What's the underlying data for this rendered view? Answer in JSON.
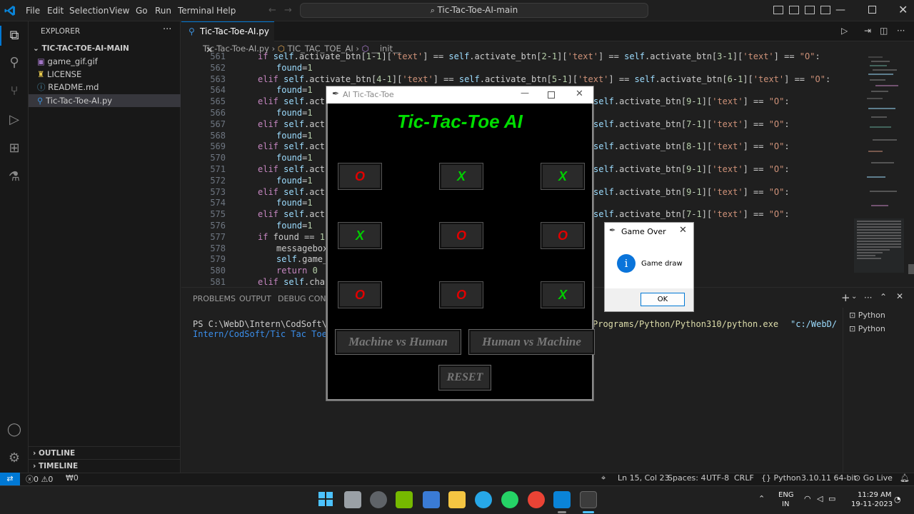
{
  "titlebar": {
    "menus": [
      "File",
      "Edit",
      "Selection",
      "View",
      "Go",
      "Run",
      "Terminal",
      "Help"
    ],
    "search": "Tic-Tac-Toe-AI-main"
  },
  "sidebar": {
    "header": "EXPLORER",
    "root": "TIC-TAC-TOE-AI-MAIN",
    "files": [
      "game_gif.gif",
      "LICENSE",
      "README.md",
      "Tic-Tac-Toe-AI.py"
    ],
    "outline": "OUTLINE",
    "timeline": "TIMELINE"
  },
  "editor": {
    "tab": "Tic-Tac-Toe-AI.py",
    "breadcrumb": [
      "Tic-Tac-Toe-AI.py",
      "TIC_TAC_TOE_AI",
      "__init__"
    ],
    "lines": [
      {
        "n": "561",
        "indent": 0,
        "kind": "partial",
        "text": "if self.activate_btn[1-1]['text'] == self.activate_btn[2-1]['text'] == self.activate_btn[3-1]['text'] == \"O\":"
      },
      {
        "n": "562",
        "indent": 1,
        "kind": "assign",
        "text": "found=1"
      },
      {
        "n": "563",
        "indent": 0,
        "kind": "elif_full",
        "text": "elif self.activate_btn[4-1]['text'] == self.activate_btn[5-1]['text'] == self.activate_btn[6-1]['text'] == \"O\":"
      },
      {
        "n": "564",
        "indent": 1,
        "kind": "assign",
        "text": "found=1"
      },
      {
        "n": "565",
        "indent": 0,
        "kind": "elif_cut",
        "text": "elif self.activ",
        "tail": "self.activate_btn[9-1]['text'] == \"O\":"
      },
      {
        "n": "566",
        "indent": 1,
        "kind": "assign",
        "text": "found=1"
      },
      {
        "n": "567",
        "indent": 0,
        "kind": "elif_cut",
        "text": "elif self.activ",
        "tail": "self.activate_btn[7-1]['text'] == \"O\":"
      },
      {
        "n": "568",
        "indent": 1,
        "kind": "assign",
        "text": "found=1"
      },
      {
        "n": "569",
        "indent": 0,
        "kind": "elif_cut",
        "text": "elif self.activ",
        "tail": "self.activate_btn[8-1]['text'] == \"O\":"
      },
      {
        "n": "570",
        "indent": 1,
        "kind": "assign",
        "text": "found=1"
      },
      {
        "n": "571",
        "indent": 0,
        "kind": "elif_cut",
        "text": "elif self.activ",
        "tail": "self.activate_btn[9-1]['text'] == \"O\":"
      },
      {
        "n": "572",
        "indent": 1,
        "kind": "assign",
        "text": "found=1"
      },
      {
        "n": "573",
        "indent": 0,
        "kind": "elif_cut",
        "text": "elif self.activ",
        "tail": "self.activate_btn[9-1]['text'] == \"O\":"
      },
      {
        "n": "574",
        "indent": 1,
        "kind": "assign",
        "text": "found=1"
      },
      {
        "n": "575",
        "indent": 0,
        "kind": "elif_cut",
        "text": "elif self.activ",
        "tail": "self.activate_btn[7-1]['text'] == \"O\":"
      },
      {
        "n": "576",
        "indent": 1,
        "kind": "assign",
        "text": "found=1"
      },
      {
        "n": "577",
        "indent": 0,
        "kind": "if",
        "text": "if found == 1:"
      },
      {
        "n": "578",
        "indent": 1,
        "kind": "call",
        "text": "messagebox."
      },
      {
        "n": "579",
        "indent": 1,
        "kind": "call",
        "text": "self.game_o"
      },
      {
        "n": "580",
        "indent": 1,
        "kind": "ret",
        "text": "return 0"
      },
      {
        "n": "581",
        "indent": 0,
        "kind": "elif_cut2",
        "text": "elif self.chanc"
      }
    ]
  },
  "panel": {
    "tabs": [
      "PROBLEMS",
      "OUTPUT",
      "DEBUG CONSOL"
    ],
    "terminal_line1_a": "PS C:\\WebD\\Intern\\CodSoft\\Tic T",
    "terminal_line1_b": "Programs/Python/Python310/python.exe",
    "terminal_line1_c": "\"c:/WebD/",
    "terminal_line2": "Intern/CodSoft/Tic Tac Toe AI/T",
    "shells": [
      "Python",
      "Python"
    ]
  },
  "statusbar": {
    "errors": "0",
    "warnings": "0",
    "ports": "0",
    "position": "Ln 15, Col 23",
    "spaces": "Spaces: 4",
    "encoding": "UTF-8",
    "eol": "CRLF",
    "language": "Python",
    "interpreter": "3.10.11 64-bit",
    "golive": "Go Live"
  },
  "taskbar": {
    "lang1": "ENG",
    "lang2": "IN",
    "time": "11:29 AM",
    "date": "19-11-2023"
  },
  "ttt": {
    "window_title": "AI Tic-Tac-Toe",
    "heading": "Tic-Tac-Toe AI",
    "board": [
      "O",
      "X",
      "X",
      "X",
      "O",
      "O",
      "O",
      "O",
      "X"
    ],
    "mode1": "Machine vs Human",
    "mode2": "Human vs Machine",
    "reset": "RESET"
  },
  "dialog": {
    "title": "Game Over",
    "message": "Game draw",
    "ok": "OK"
  }
}
